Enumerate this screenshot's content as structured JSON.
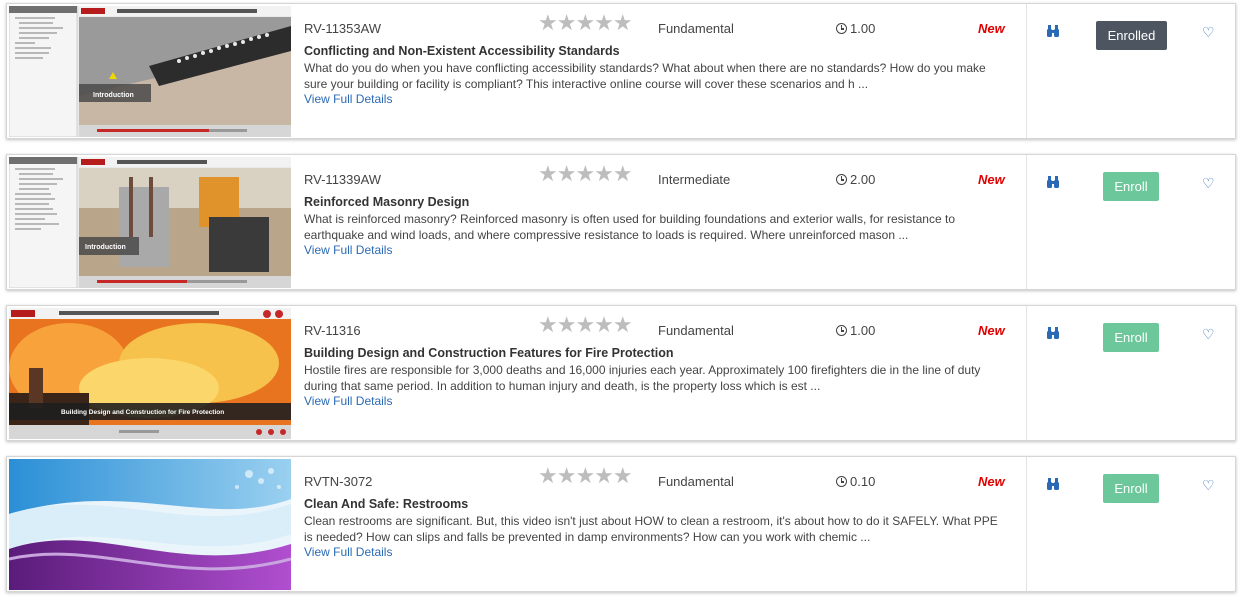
{
  "courses": [
    {
      "code": "RV-11353AW",
      "rating": "★★★★★",
      "level": "Fundamental",
      "hours": "1.00",
      "badge": "New",
      "title": "Conflicting and Non-Existent Accessibility Standards",
      "description": "What do you do when you have conflicting accessibility standards? What about when there are no standards? How do you make sure your building or facility is compliant? This interactive online course will cover these scenarios and h ...",
      "details_link": "View Full Details",
      "action_label": "Enrolled",
      "thumbnail": {
        "header": "Conflicting and Non-existent Accessibility Standards",
        "caption": "Introduction"
      }
    },
    {
      "code": "RV-11339AW",
      "rating": "★★★★★",
      "level": "Intermediate",
      "hours": "2.00",
      "badge": "New",
      "title": "Reinforced Masonry Design",
      "description": "What is reinforced masonry? Reinforced masonry is often used for building foundations and exterior walls, for resistance to earthquake and wind loads, and where compressive resistance to loads is required. Where unreinforced mason ...",
      "details_link": "View Full Details",
      "action_label": "Enroll",
      "thumbnail": {
        "header": "Reinforced Masonry Design",
        "caption": "Introduction"
      }
    },
    {
      "code": "RV-11316",
      "rating": "★★★★★",
      "level": "Fundamental",
      "hours": "1.00",
      "badge": "New",
      "title": "Building Design and Construction Features for Fire Protection",
      "description": "Hostile fires are responsible for 3,000 deaths and 16,000 injuries each year. Approximately 100 firefighters die in the line of duty during that same period. In addition to human injury and death, is the property loss which is est ...",
      "details_link": "View Full Details",
      "action_label": "Enroll",
      "thumbnail": {
        "header": "Building Design and Construction Features for Fire Protection",
        "caption": "Building Design and Construction for Fire Protection"
      }
    },
    {
      "code": "RVTN-3072",
      "rating": "★★★★★",
      "level": "Fundamental",
      "hours": "0.10",
      "badge": "New",
      "title": "Clean And Safe: Restrooms",
      "description": "Clean restrooms are significant. But, this video isn't just about HOW to clean a restroom, it's about how to do it SAFELY. What PPE is needed? How can slips and falls be prevented in damp environments? How can you work with chemic ...",
      "details_link": "View Full Details",
      "action_label": "Enroll",
      "thumbnail": {
        "header": "",
        "caption": ""
      }
    }
  ],
  "colors": {
    "enrolled_button": "#4d5660",
    "enroll_button": "#6cc89b",
    "new_badge": "#e00000",
    "link": "#2a6ab5",
    "stars": "#bdbdbd"
  },
  "icons": {
    "preview": "binoculars-icon",
    "favorite": "heart-outline-icon",
    "duration": "clock-icon"
  }
}
